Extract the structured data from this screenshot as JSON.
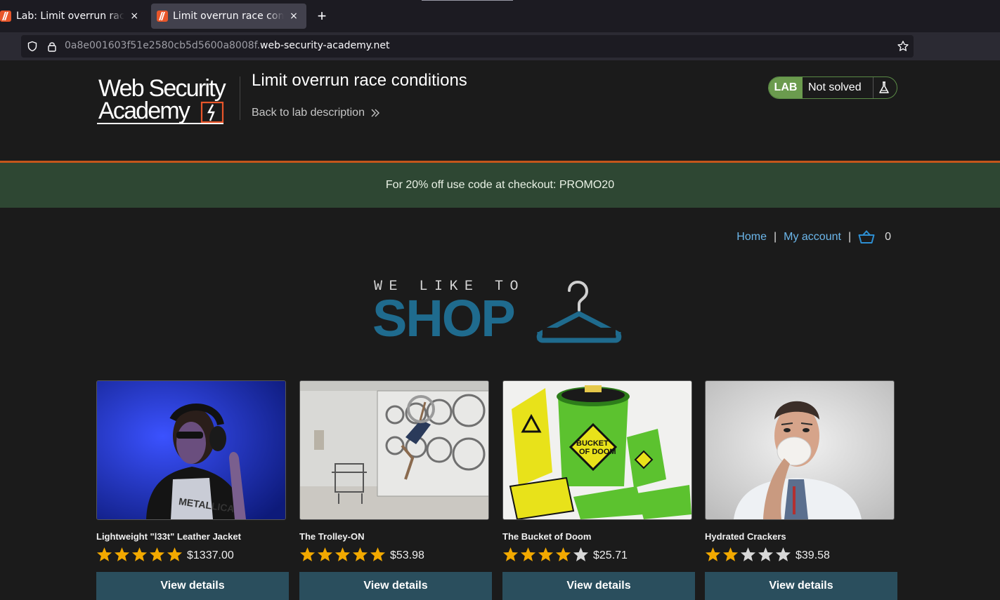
{
  "browser": {
    "tabs": [
      {
        "title": "Lab: Limit overrun race conditions",
        "active": false
      },
      {
        "title": "Limit overrun race conditions",
        "active": true
      }
    ],
    "new_tab": "+",
    "close": "×",
    "url_subdomain": "0a8e001603f51e2580cb5d5600a8008f.",
    "url_domain": "web-security-academy.net"
  },
  "header": {
    "logo_line1": "Web Security",
    "logo_line2": "Academy",
    "lab_title": "Limit overrun race conditions",
    "back_link": "Back to lab description",
    "badge_label": "LAB",
    "status": "Not solved"
  },
  "promo": {
    "text": "For 20% off use code at checkout: PROMO20"
  },
  "nav": {
    "home": "Home",
    "separator": "|",
    "account": "My account",
    "cart_count": "0"
  },
  "shop_logo": {
    "tagline": "WE LIKE TO",
    "word": "SHOP"
  },
  "products": [
    {
      "name": "Lightweight \"l33t\" Leather Jacket",
      "rating": 5,
      "price": "$1337.00",
      "button": "View details"
    },
    {
      "name": "The Trolley-ON",
      "rating": 5,
      "price": "$53.98",
      "button": "View details"
    },
    {
      "name": "The Bucket of Doom",
      "rating": 4,
      "price": "$25.71",
      "button": "View details"
    },
    {
      "name": "Hydrated Crackers",
      "rating": 2,
      "price": "$39.58",
      "button": "View details"
    }
  ],
  "colors": {
    "accent_link": "#6cb7eb",
    "button_bg": "#2a4e5d",
    "promo_bg": "#2e4733",
    "lab_green": "#6b9b4e",
    "header_rule": "#c4561b",
    "star_gold": "#f2a900"
  }
}
